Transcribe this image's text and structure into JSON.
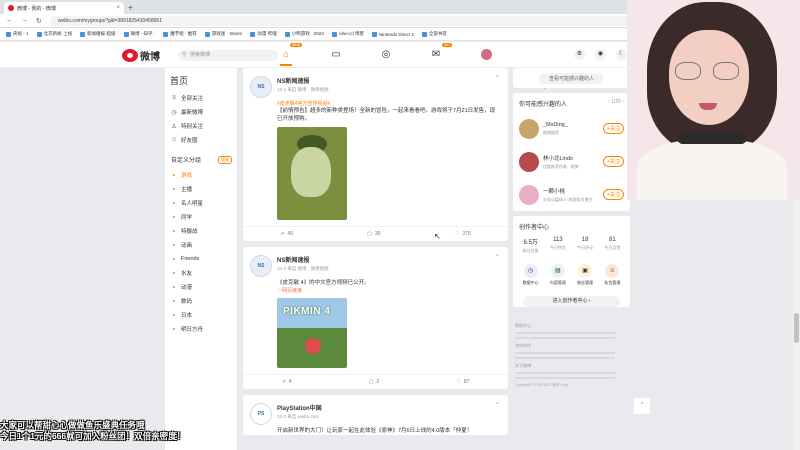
{
  "browser": {
    "tab_title": "微博 - 我的 - 微博",
    "url": "weibo.com/mygroups?gid=3891825410458051",
    "bookmarks": [
      "央视 - 1",
      "北京新闻·上线",
      "新闻播报·超级",
      "微博 - 知乎 ·",
      "魔芋组 · 推荐",
      "游戏迷 · Steam",
      "动漫·哔哩",
      "小鸭游戏 · 2023",
      "cdw-ccl 博客",
      "Nintendo Direct 2",
      "全部书签"
    ]
  },
  "topnav": {
    "logo_text": "微博",
    "search_placeholder": "搜索微博",
    "home_badge": "NEW",
    "msg_badge": "99+"
  },
  "sidebar": {
    "home_label": "首页",
    "items": [
      {
        "icon": "≡",
        "label": "全部关注"
      },
      {
        "icon": "◷",
        "label": "最新微博"
      },
      {
        "icon": "♙",
        "label": "特别关注"
      },
      {
        "icon": "☺",
        "label": "好友圈"
      }
    ],
    "custom_title": "自定义分组",
    "manage_label": "管理",
    "groups": [
      "游戏",
      "主播",
      "名人明星",
      "同学",
      "特摄战",
      "动画",
      "Friends",
      "水友",
      "动漫",
      "数码",
      "日本",
      "明日方舟"
    ]
  },
  "feed": {
    "posts": [
      {
        "avatar": "NS",
        "name": "NS新闻速报",
        "meta": "12-2 来自 微博 · 微博视频",
        "tag": "#皮克敏4官方宣传视频#",
        "text": "【前情预告】超多的新种类登场！全新的冒险，一起来看看吧。游戏将于7月21日发售，现已开放预购。",
        "link": "",
        "stats": {
          "repost": "49",
          "comment": "39",
          "like": "375"
        }
      },
      {
        "avatar": "NS",
        "name": "NS新闻速报",
        "meta": "12-2 来自 微博 · 微博视频",
        "tag": "",
        "text": "《皮克敏 4》的中文官方视频已公开。",
        "link": "◇网页链接",
        "image_title": "PIKMIN 4",
        "stats": {
          "repost": "4",
          "comment": "2",
          "like": "87"
        }
      },
      {
        "avatar": "PS",
        "name": "PlayStation中国",
        "meta": "12-2 来自 weibo.com",
        "tag": "",
        "text": "开启新世界的大门！让玩家一起在此体验《原神》7月6日上线的4.0版本「仲夏！",
        "link": "",
        "stats": {
          "repost": "",
          "comment": "",
          "like": ""
        }
      }
    ]
  },
  "right": {
    "top_button": "查看可能感兴趣的人",
    "suggest_title": "你可能感兴趣的人",
    "suggest_page": "1/20",
    "follow_label": "+关注",
    "suggestions": [
      {
        "name": "_MsDing_",
        "reason": "微博推荐",
        "color": "#c8a46a"
      },
      {
        "name": "林小北Lindo",
        "reason": "优酷推荐作者 · 微博",
        "color": "#b84a4a"
      },
      {
        "name": "一颗小桃",
        "reason": "头条自媒体人·旅游知名博主",
        "color": "#e8b0c8"
      }
    ],
    "creator_title": "创作者中心",
    "creator_stats": [
      {
        "value": "6.5万",
        "label": "粉丝总量"
      },
      {
        "value": "113",
        "label": "今日转发"
      },
      {
        "value": "18",
        "label": "今日评论"
      },
      {
        "value": "81",
        "label": "今日点赞"
      }
    ],
    "creator_tools": [
      {
        "icon": "◷",
        "label": "数据中心",
        "color": "#e8eefc"
      },
      {
        "icon": "▤",
        "label": "内容管理",
        "color": "#e6f4fb"
      },
      {
        "icon": "▣",
        "label": "粉丝管理",
        "color": "#fdf2d9"
      },
      {
        "icon": "☺",
        "label": "私信管理",
        "color": "#fde6d6"
      }
    ],
    "enter_label": "进入创作者中心 ›",
    "footer_sections": [
      "帮助中心",
      "合作伙伴",
      "关于微博"
    ],
    "copyright": "Copyright © 2009-2023 微博 Corp"
  },
  "overlay": {
    "chat_lines": [
      "大家可以帮甜心心做做鱼乐盛典任务哦",
      "今日1个1元的666就可加入粉丝团！双倍亲密度！"
    ]
  }
}
